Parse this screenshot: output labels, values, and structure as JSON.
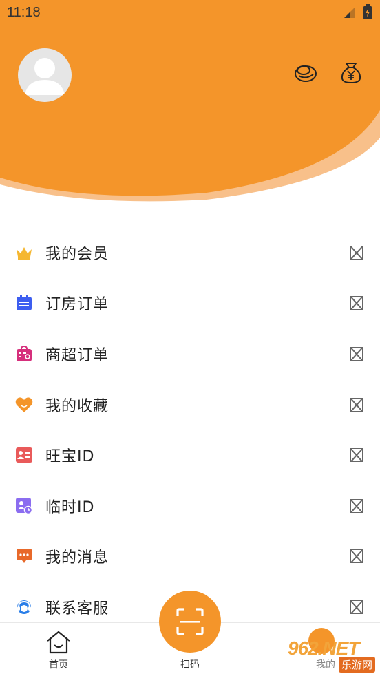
{
  "status_bar": {
    "time": "11:18"
  },
  "header": {
    "bg_color": "#f4952a",
    "accent_color": "#f7b46a",
    "icons": [
      "coin-icon",
      "wallet-icon"
    ]
  },
  "menu": {
    "items": [
      {
        "label": "我的会员",
        "icon": "crown-icon",
        "color": "#f5b731"
      },
      {
        "label": "订房订单",
        "icon": "calendar-icon",
        "color": "#3d5ef0"
      },
      {
        "label": "商超订单",
        "icon": "shopping-bag-icon",
        "color": "#d62f7c"
      },
      {
        "label": "我的收藏",
        "icon": "heart-icon",
        "color": "#f4952a"
      },
      {
        "label": "旺宝ID",
        "icon": "id-card-icon",
        "color": "#e95a5a"
      },
      {
        "label": "临时ID",
        "icon": "temp-id-icon",
        "color": "#8b6df0"
      },
      {
        "label": "我的消息",
        "icon": "message-icon",
        "color": "#e8692a"
      },
      {
        "label": "联系客服",
        "icon": "customer-service-icon",
        "color": "#2a7ee8"
      }
    ]
  },
  "tabbar": {
    "home_label": "首页",
    "scan_label": "扫码",
    "mine_label": "我的"
  },
  "watermark": {
    "big": "962.NET",
    "small": "乐游网"
  }
}
